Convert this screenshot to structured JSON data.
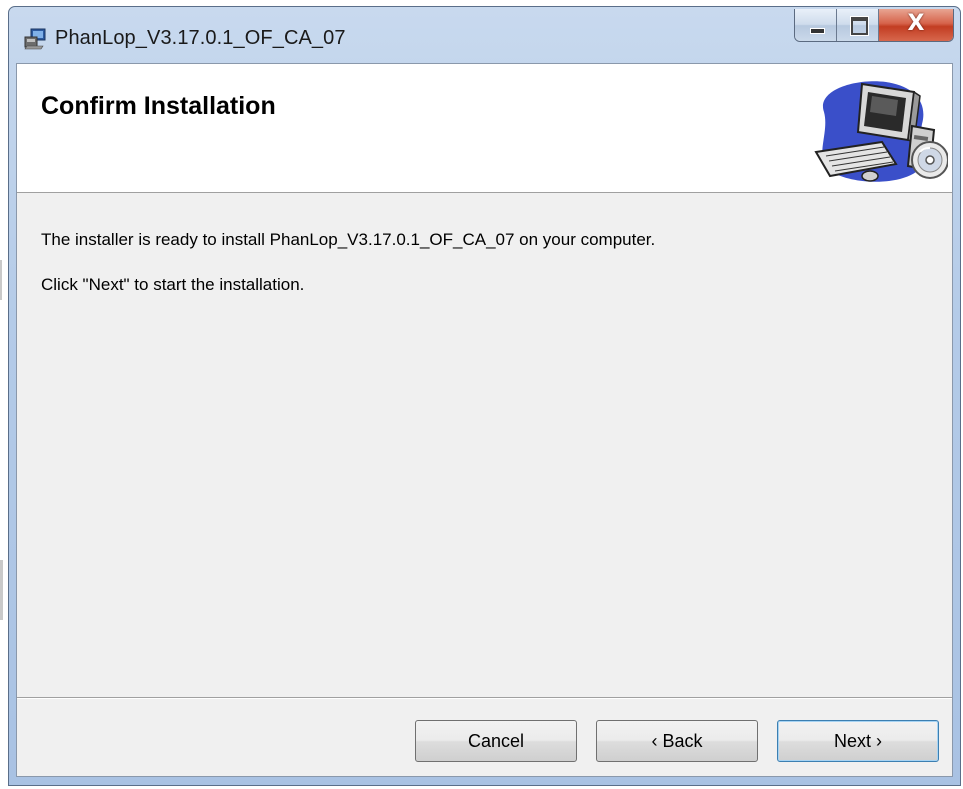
{
  "window": {
    "title": "PhanLop_V3.17.0.1_OF_CA_07",
    "controls": {
      "minimize_icon": "minimize-icon",
      "maximize_icon": "maximize-icon",
      "close_glyph": "X"
    }
  },
  "banner": {
    "title": "Confirm Installation",
    "art_icon": "computer-cd-icon"
  },
  "body": {
    "line1": "The installer is ready to install PhanLop_V3.17.0.1_OF_CA_07 on your computer.",
    "line2": "Click \"Next\" to start the installation."
  },
  "buttons": {
    "cancel": "Cancel",
    "back": "‹ Back",
    "next": "Next ›"
  },
  "colors": {
    "frame": "#b4cbe8",
    "client": "#f0f0f0",
    "close_button": "#c23d22",
    "default_button_border": "#3c7fb1"
  }
}
